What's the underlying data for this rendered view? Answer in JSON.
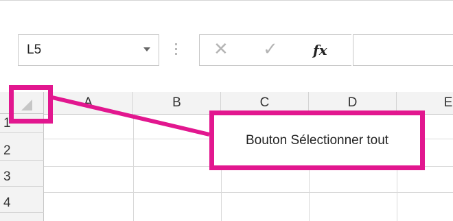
{
  "name_box": {
    "value": "L5"
  },
  "formula_bar": {
    "cancel_glyph": "✕",
    "enter_glyph": "✓",
    "fx_label": "fx",
    "value": ""
  },
  "columns": [
    "A",
    "B",
    "C",
    "D",
    "E"
  ],
  "rows": [
    "1",
    "2",
    "3",
    "4"
  ],
  "callout": {
    "label": "Bouton Sélectionner tout",
    "color": "#e2178f"
  }
}
